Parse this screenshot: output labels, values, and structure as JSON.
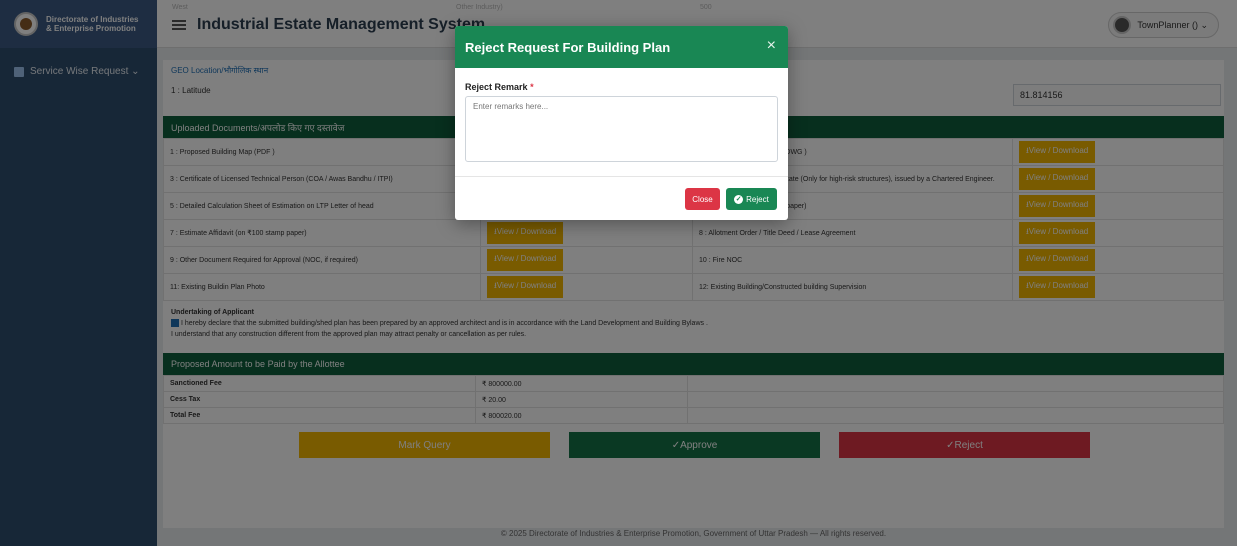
{
  "brand": {
    "line1": "Directorate of Industries",
    "line2": "& Enterprise Promotion"
  },
  "header": {
    "app_title": "Industrial Estate Management System",
    "faint_left": "West",
    "faint_mid": "Other Industry)",
    "faint_right": "500",
    "user": "TownPlanner () ⌄"
  },
  "sidebar": {
    "items": [
      {
        "label": "Service Wise Request  ⌄"
      }
    ]
  },
  "geo": {
    "label": "GEO Location/भौगोलिक स्थान",
    "latitude_label": "1 : Latitude",
    "longitude_value": "81.814156"
  },
  "documents": {
    "header": "Uploaded Documents/अपलोड किए गए दस्तावेज",
    "view_label": "⭳View / Download",
    "rows": [
      {
        "left": "1 : Proposed Building Map (PDF )",
        "right": "2 : Proposed Building Map (DWG )"
      },
      {
        "left": "3 : Certificate of Licensed Technical Person (COA / Awas Bandhu / ITPI)",
        "right": "4 : Structural Stability Certificate (Only for high-risk structures), issued by a Chartered Engineer."
      },
      {
        "left": "5 : Detailed Calculation Sheet of Estimation on LTP Letter of head",
        "right": "6 : Affidavit (on ₹100 stamp paper)"
      },
      {
        "left": "7 : Estimate Affidavit (on ₹100 stamp paper)",
        "right": "8 : Allotment Order / Title Deed / Lease Agreement"
      },
      {
        "left": "9 : Other Document Required for Approval (NOC, if required)",
        "right": "10 : Fire NOC"
      },
      {
        "left": "11: Existing Buildin Plan Photo",
        "right": "12: Existing Building/Constructed building Supervision"
      }
    ]
  },
  "undertaking": {
    "title": "Undertaking of Applicant",
    "line1": "I hereby declare that the submitted building/shed plan has been prepared by an approved architect and is in accordance with the Land Development and Building Bylaws .",
    "line2": "I understand that any construction different from the approved plan may attract penalty or cancellation as per rules."
  },
  "fees": {
    "header": "Proposed Amount to be Paid by the Allottee",
    "rows": [
      {
        "label": "Sanctioned Fee",
        "value": "₹ 800000.00"
      },
      {
        "label": "Cess Tax",
        "value": "₹ 20.00"
      },
      {
        "label": "Total Fee",
        "value": "₹ 800020.00"
      }
    ]
  },
  "actions": {
    "mark_query": "Mark Query",
    "approve": "✓Approve",
    "reject": "✓Reject"
  },
  "footer": "© 2025 Directorate of Industries & Enterprise Promotion, Government of Uttar Pradesh — All rights reserved.",
  "modal": {
    "title": "Reject Request For Building Plan",
    "close_glyph": "×",
    "remark_label": "Reject Remark",
    "required_mark": "*",
    "remark_placeholder": "Enter remarks here...",
    "remark_value": "",
    "close_button": "Close",
    "reject_button": "Reject"
  },
  "colors": {
    "modal_header": "#198754",
    "reject_red": "#dc3545",
    "view_yellow": "#f2b600",
    "section_green": "#0f5f3d"
  },
  "icons": [
    "menu-icon",
    "user-avatar-icon",
    "modal-close-icon",
    "check-circle-icon",
    "grid-icon",
    "download-icon",
    "checkbox-icon"
  ]
}
